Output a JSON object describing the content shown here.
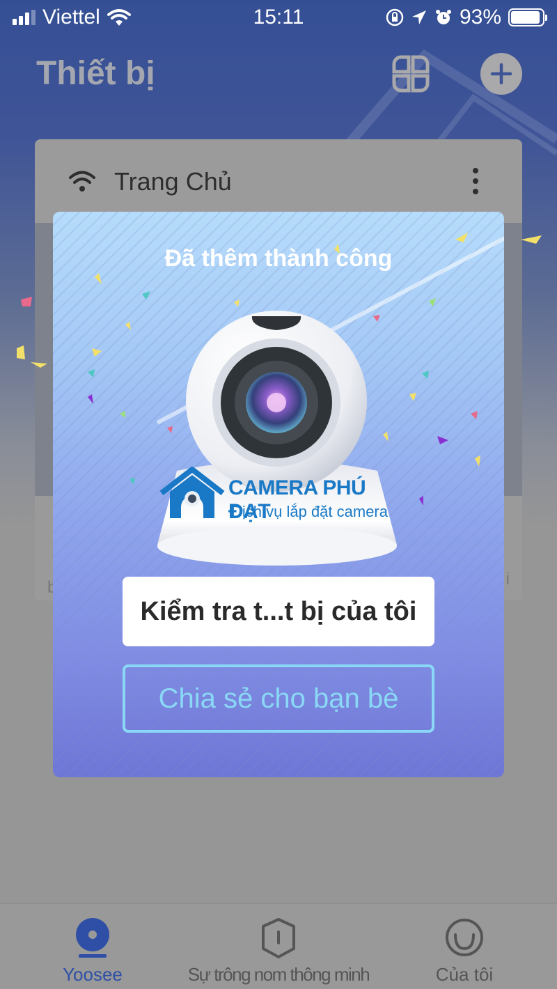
{
  "status_bar": {
    "carrier": "Viettel",
    "time": "15:11",
    "battery_percent": "93%",
    "battery_level": 0.93,
    "icons": [
      "signal-icon",
      "wifi-icon",
      "rotation-lock-icon",
      "location-icon",
      "alarm-icon",
      "battery-icon"
    ]
  },
  "header": {
    "title": "Thiết bị",
    "grid_view_icon": "grid-view-icon",
    "add_icon": "plus-icon"
  },
  "device_card": {
    "name": "Trang Chủ",
    "status_icon": "wifi-icon",
    "menu_icon": "more-vertical-icon",
    "footer_left_partial": "b",
    "footer_right_partial": "i"
  },
  "modal": {
    "title": "Đã thêm thành công",
    "watermark_brand": "CAMERA PHÚ ĐẠT",
    "watermark_tagline": "Dịch vụ lắp đặt camera",
    "primary_button": "Kiểm tra t...t bị của tôi",
    "secondary_button": "Chia sẻ cho bạn bè",
    "colors": {
      "top": "#b6dcfb",
      "bottom": "#6e76d6",
      "secondary_button": "#8ad8f5",
      "watermark": "#1a79c6"
    }
  },
  "tab_bar": {
    "active_color": "#2f4fa6",
    "tabs": [
      {
        "label": "Yoosee",
        "icon": "camera-icon",
        "active": true
      },
      {
        "label": "Sự trông nom thông minh",
        "icon": "shield-icon",
        "active": false
      },
      {
        "label": "Của tôi",
        "icon": "smile-icon",
        "active": false
      }
    ]
  }
}
